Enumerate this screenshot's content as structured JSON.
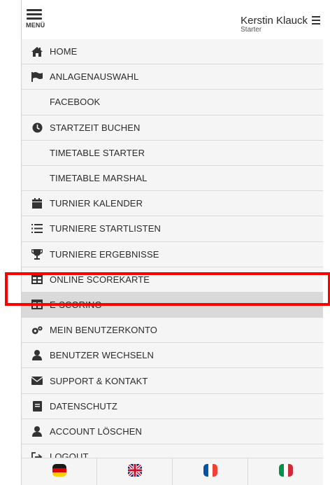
{
  "header": {
    "menu_label": "MENÜ",
    "user_name": "Kerstin Klauck",
    "user_role": "Starter"
  },
  "nav": {
    "items": [
      {
        "label": "HOME",
        "icon": "home-icon"
      },
      {
        "label": "ANLAGENAUSWAHL",
        "icon": "flag-icon"
      },
      {
        "label": "FACEBOOK",
        "icon": ""
      },
      {
        "label": "STARTZEIT BUCHEN",
        "icon": "clock-icon"
      },
      {
        "label": "TIMETABLE STARTER",
        "icon": ""
      },
      {
        "label": "TIMETABLE MARSHAL",
        "icon": ""
      },
      {
        "label": "TURNIER KALENDER",
        "icon": "calendar-icon"
      },
      {
        "label": "TURNIERE STARTLISTEN",
        "icon": "list-icon"
      },
      {
        "label": "TURNIERE ERGEBNISSE",
        "icon": "trophy-icon"
      },
      {
        "label": "ONLINE SCOREKARTE",
        "icon": "table-icon"
      },
      {
        "label": "E-SCORING",
        "icon": "table-icon"
      },
      {
        "label": "MEIN BENUTZERKONTO",
        "icon": "gears-icon"
      },
      {
        "label": "BENUTZER WECHSELN",
        "icon": "user-icon"
      },
      {
        "label": "SUPPORT & KONTAKT",
        "icon": "envelope-icon"
      },
      {
        "label": "DATENSCHUTZ",
        "icon": "document-icon"
      },
      {
        "label": "ACCOUNT LÖSCHEN",
        "icon": "user-icon"
      },
      {
        "label": "LOGOUT",
        "icon": "sign-out-icon"
      }
    ],
    "active_index": 10
  },
  "languages": [
    {
      "name": "de-flag-icon"
    },
    {
      "name": "gb-flag-icon"
    },
    {
      "name": "fr-flag-icon"
    },
    {
      "name": "it-flag-icon"
    }
  ],
  "colors": {
    "highlight": "#ff0000",
    "active_bg": "#d9d9d9",
    "item_bg": "#f5f5f5"
  }
}
